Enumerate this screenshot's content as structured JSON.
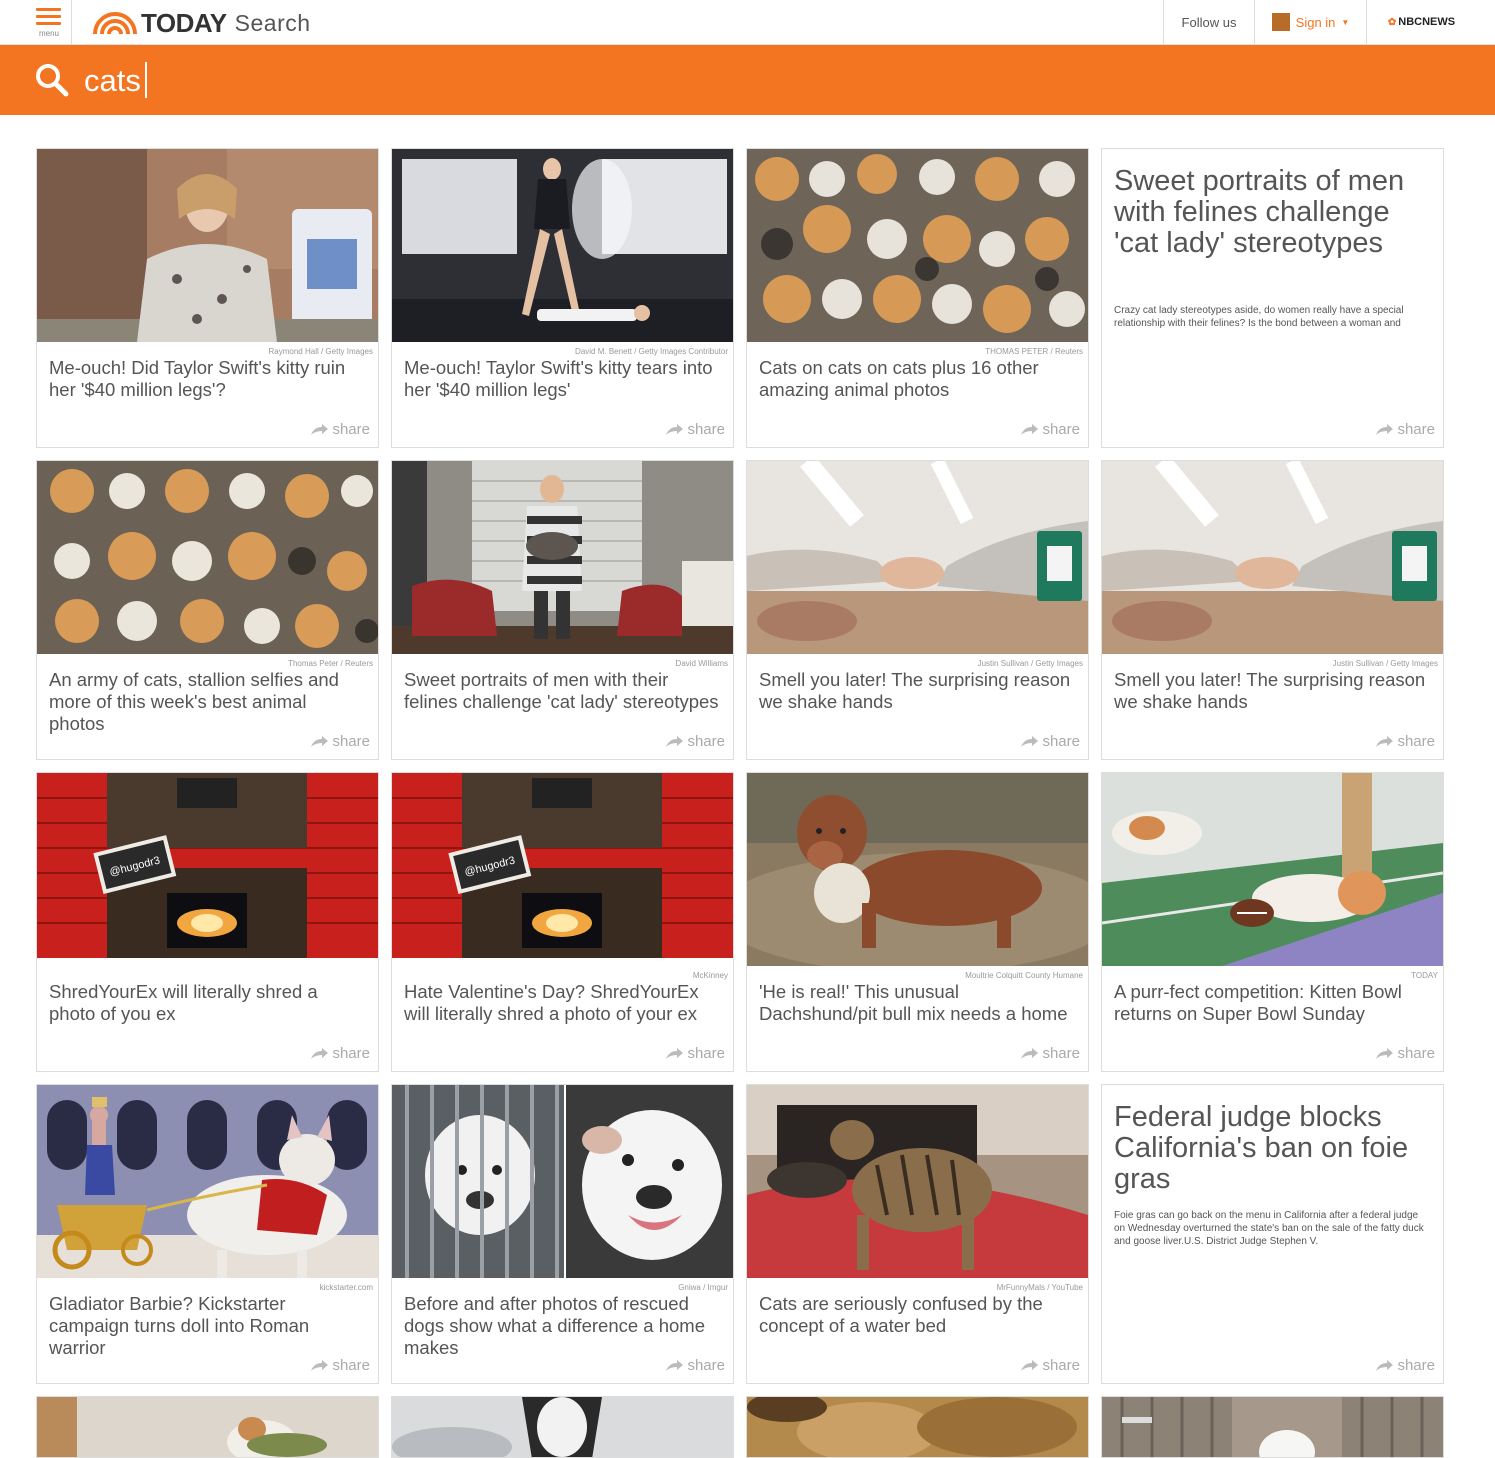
{
  "header": {
    "menu_label": "menu",
    "logo_text": "TODAY",
    "logo_section": "Search",
    "follow_label": "Follow us",
    "signin_label": "Sign in",
    "network_label": "NBCNEWS"
  },
  "search": {
    "value": "cats"
  },
  "share_label": "share",
  "cards": [
    {
      "credit": "Raymond Hall / Getty Images",
      "title": "Me-ouch! Did Taylor Swift's kitty ruin her '$40 million legs'?"
    },
    {
      "credit": "David M. Benett / Getty Images Contributor",
      "title": "Me-ouch! Taylor Swift's kitty tears into her '$40 million legs'"
    },
    {
      "credit": "THOMAS PETER / Reuters",
      "title": "Cats on cats on cats plus 16 other amazing animal photos"
    },
    {
      "title": "Sweet portraits of men with felines challenge 'cat lady' stereotypes",
      "description": "Crazy cat lady stereotypes aside, do women really have a special relationship with their felines? Is the bond between a woman and"
    },
    {
      "credit": "Thomas Peter / Reuters",
      "title": "An army of cats, stallion selfies and more of this week's best animal photos"
    },
    {
      "credit": "David Williams",
      "title": "Sweet portraits of men with their felines challenge 'cat lady' stereotypes"
    },
    {
      "credit": "Justin Sullivan / Getty Images",
      "title": "Smell you later! The surprising reason we shake hands"
    },
    {
      "credit": "Justin Sullivan / Getty Images",
      "title": "Smell you later! The surprising reason we shake hands"
    },
    {
      "credit": "",
      "title": "ShredYourEx will literally shred a photo of you ex"
    },
    {
      "credit": "McKinney",
      "title": "Hate Valentine's Day? ShredYourEx will literally shred a photo of your ex"
    },
    {
      "credit": "Moultrie Colquitt County Humane",
      "title": "'He is real!' This unusual Dachshund/pit bull mix needs a home"
    },
    {
      "credit": "TODAY",
      "title": "A purr-fect competition: Kitten Bowl returns on Super Bowl Sunday"
    },
    {
      "credit": "kickstarter.com",
      "title": "Gladiator Barbie? Kickstarter campaign turns doll into Roman warrior"
    },
    {
      "credit": "Gniwa / Imgur",
      "title": "Before and after photos of rescued dogs show what a difference a home makes"
    },
    {
      "credit": "MrFunnyMals / YouTube",
      "title": "Cats are seriously confused by the concept of a water bed"
    },
    {
      "title": "Federal judge blocks California's ban on foie gras",
      "description": "Foie gras can go back on the menu in California after a federal judge on Wednesday overturned the state's ban on the sale of the fatty duck and goose liver.U.S. District Judge Stephen V."
    }
  ],
  "sign_text": "@hugodr3",
  "colors": {
    "accent": "#f47521"
  }
}
